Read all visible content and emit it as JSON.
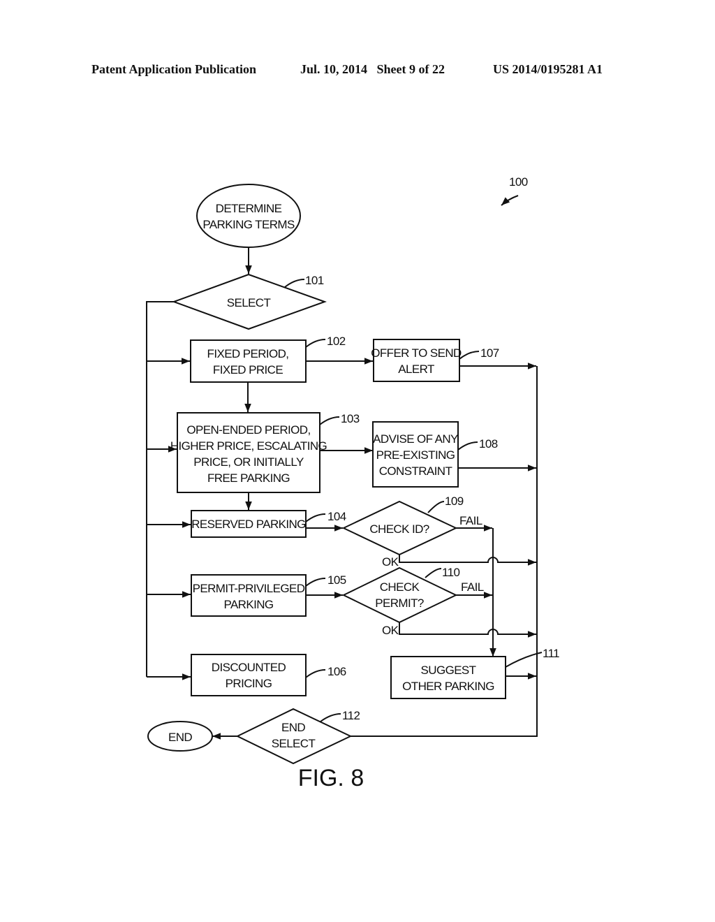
{
  "header": {
    "publication": "Patent Application Publication",
    "date_sheet": "Jul. 10, 2014   Sheet 9 of 22",
    "number": "US 2014/0195281 A1"
  },
  "figure": {
    "ref": "100",
    "caption": "FIG. 8",
    "start": {
      "line1": "DETERMINE",
      "line2": "PARKING TERMS"
    },
    "select": {
      "label": "SELECT",
      "ref": "101"
    },
    "box102": {
      "line1": "FIXED PERIOD,",
      "line2": "FIXED PRICE",
      "ref": "102"
    },
    "box103": {
      "line1": "OPEN-ENDED PERIOD,",
      "line2": "HIGHER PRICE, ESCALATING",
      "line3": "PRICE, OR INITIALLY",
      "line4": "FREE PARKING",
      "ref": "103"
    },
    "box104": {
      "line1": "RESERVED PARKING",
      "ref": "104"
    },
    "box105": {
      "line1": "PERMIT-PRIVILEGED",
      "line2": "PARKING",
      "ref": "105"
    },
    "box106": {
      "line1": "DISCOUNTED",
      "line2": "PRICING",
      "ref": "106"
    },
    "box107": {
      "line1": "OFFER TO SEND",
      "line2": "ALERT",
      "ref": "107"
    },
    "box108": {
      "line1": "ADVISE OF ANY",
      "line2": "PRE-EXISTING",
      "line3": "CONSTRAINT",
      "ref": "108"
    },
    "dec109": {
      "line1": "CHECK ID?",
      "ref": "109",
      "fail": "FAIL",
      "ok": "OK"
    },
    "dec110": {
      "line1": "CHECK",
      "line2": "PERMIT?",
      "ref": "110",
      "fail": "FAIL",
      "ok": "OK"
    },
    "box111": {
      "line1": "SUGGEST",
      "line2": "OTHER PARKING",
      "ref": "111"
    },
    "dec112": {
      "line1": "END",
      "line2": "SELECT",
      "ref": "112"
    },
    "end": {
      "label": "END"
    }
  }
}
